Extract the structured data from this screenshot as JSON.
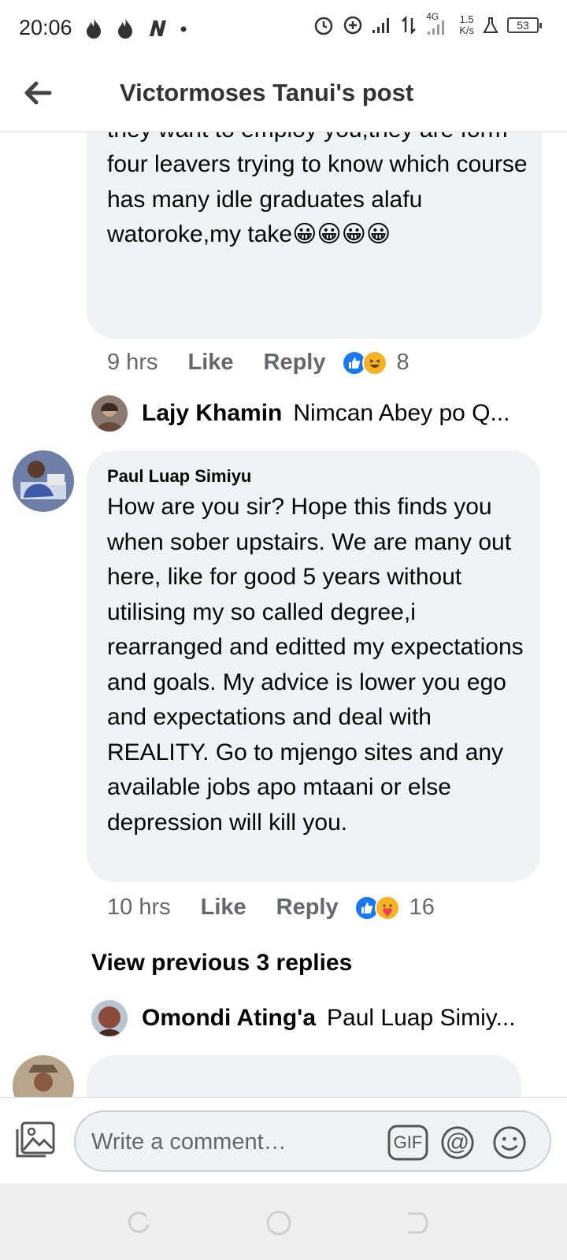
{
  "status_bar": {
    "time": "20:06",
    "network": "4G",
    "speed_value": "1.5",
    "speed_unit": "K/s",
    "battery": "53"
  },
  "header": {
    "title": "Victormoses Tanui's post",
    "back_icon": "arrow-left-icon"
  },
  "comments": [
    {
      "text": "which course did you graduate? Si ati they want to employ you,they are form four leavers trying to know which course has many idle graduates alafu watoroke,my take😀😀😀😀",
      "time": "9 hrs",
      "like_label": "Like",
      "reply_label": "Reply",
      "reactions": [
        "like",
        "haha"
      ],
      "reaction_count": "8",
      "reply_preview": {
        "name": "Lajy Khamin",
        "text": "Nimcan Abey po Q..."
      }
    },
    {
      "author": "Paul Luap Simiyu",
      "text": "How are you sir? Hope this finds you when sober upstairs. We are many out here, like for good 5 years without utilising my so called degree,i rearranged and editted my expectations and goals. My advice is lower you ego and expectations and deal with REALITY. Go to mjengo sites and any available jobs apo mtaani or else depression will kill you.",
      "time": "10 hrs",
      "like_label": "Like",
      "reply_label": "Reply",
      "reactions": [
        "like",
        "care"
      ],
      "reaction_count": "16",
      "view_previous": "View previous 3 replies",
      "reply_preview": {
        "name": "Omondi Ating'a",
        "text": "Paul Luap Simiy..."
      }
    }
  ],
  "composer": {
    "placeholder": "Write a comment…",
    "gif_label": "GIF",
    "mention_label": "@"
  },
  "colors": {
    "bubble": "#f0f2f5",
    "like_blue": "#1877f2",
    "meta_gray": "#65676b"
  }
}
